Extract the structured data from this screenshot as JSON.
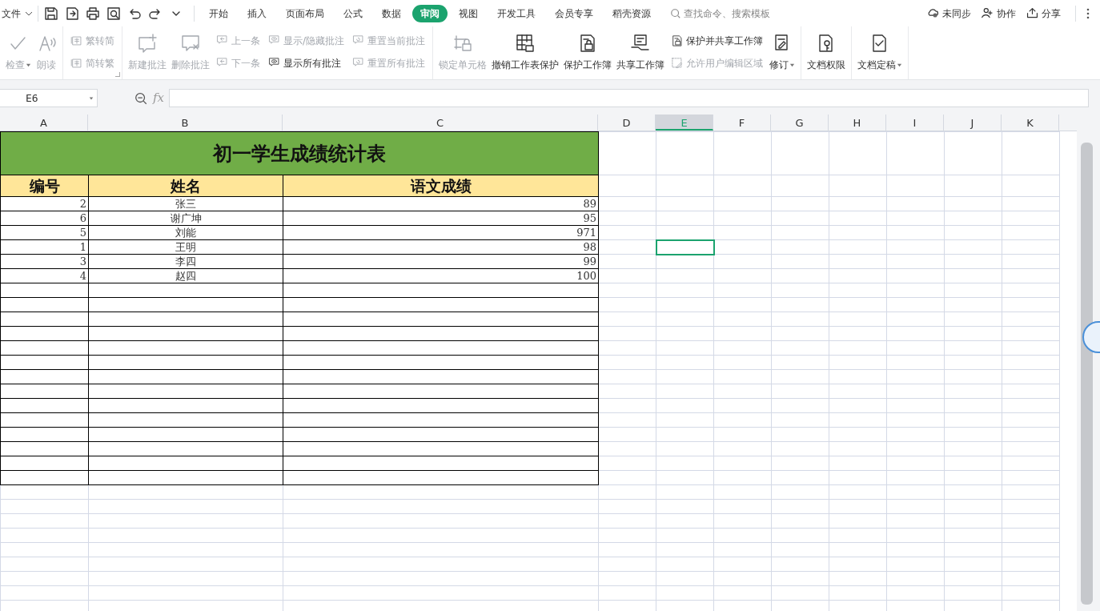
{
  "menu": {
    "file": "文件"
  },
  "tabs": [
    {
      "label": "开始",
      "selected": false
    },
    {
      "label": "插入",
      "selected": false
    },
    {
      "label": "页面布局",
      "selected": false
    },
    {
      "label": "公式",
      "selected": false
    },
    {
      "label": "数据",
      "selected": false
    },
    {
      "label": "审阅",
      "selected": true
    },
    {
      "label": "视图",
      "selected": false
    },
    {
      "label": "开发工具",
      "selected": false
    },
    {
      "label": "会员专享",
      "selected": false
    },
    {
      "label": "稻壳资源",
      "selected": false
    }
  ],
  "search": {
    "placeholder": "查找命令、搜索模板"
  },
  "actions": [
    "未同步",
    "协作",
    "分享"
  ],
  "ribbon": {
    "groups": [
      {
        "items": [
          {
            "kind": "large",
            "label": "检查",
            "disabled": true,
            "dropdown": true
          },
          {
            "kind": "large",
            "label": "朗读",
            "disabled": true
          }
        ]
      },
      {
        "launcher": true,
        "items": [
          {
            "kind": "stack",
            "items": [
              {
                "label": "繁转简",
                "disabled": true
              },
              {
                "label": "简转繁",
                "disabled": true
              }
            ]
          }
        ]
      },
      {
        "items": [
          {
            "kind": "large",
            "label": "新建批注",
            "disabled": true
          },
          {
            "kind": "large",
            "label": "删除批注",
            "disabled": true
          },
          {
            "kind": "stack",
            "items": [
              {
                "label": "上一条",
                "disabled": true
              },
              {
                "label": "下一条",
                "disabled": true
              }
            ]
          },
          {
            "kind": "stack",
            "items": [
              {
                "label": "显示/隐藏批注",
                "disabled": true
              },
              {
                "label": "显示所有批注",
                "disabled": false
              }
            ]
          },
          {
            "kind": "stack",
            "items": [
              {
                "label": "重置当前批注",
                "disabled": true
              },
              {
                "label": "重置所有批注",
                "disabled": true
              }
            ]
          }
        ]
      },
      {
        "items": [
          {
            "kind": "large",
            "label": "锁定单元格",
            "disabled": true
          },
          {
            "kind": "large",
            "label": "撤销工作表保护",
            "disabled": false
          },
          {
            "kind": "large",
            "label": "保护工作簿",
            "disabled": false
          },
          {
            "kind": "large",
            "label": "共享工作簿",
            "disabled": false
          },
          {
            "kind": "stack",
            "items": [
              {
                "label": "保护并共享工作簿",
                "disabled": false
              },
              {
                "label": "允许用户编辑区域",
                "disabled": true
              }
            ]
          },
          {
            "kind": "large",
            "label": "修订",
            "disabled": false,
            "dropdown": true
          }
        ]
      },
      {
        "items": [
          {
            "kind": "large",
            "label": "文档权限",
            "disabled": false
          }
        ]
      },
      {
        "items": [
          {
            "kind": "large",
            "label": "文档定稿",
            "disabled": false,
            "dropdown": true
          }
        ]
      }
    ]
  },
  "formula_bar": {
    "name_box": "E6",
    "fx": "fx"
  },
  "columns": [
    {
      "label": "A",
      "selected": false
    },
    {
      "label": "B",
      "selected": false
    },
    {
      "label": "C",
      "selected": false
    },
    {
      "label": "D",
      "selected": false
    },
    {
      "label": "E",
      "selected": true
    },
    {
      "label": "F",
      "selected": false
    },
    {
      "label": "G",
      "selected": false
    },
    {
      "label": "H",
      "selected": false
    },
    {
      "label": "I",
      "selected": false
    },
    {
      "label": "J",
      "selected": false
    },
    {
      "label": "K",
      "selected": false
    }
  ],
  "table": {
    "title": "初一学生成绩统计表",
    "header": [
      "编号",
      "姓名",
      "语文成绩"
    ],
    "rows": [
      {
        "cells": [
          "2",
          "张三",
          "89"
        ],
        "selected": false
      },
      {
        "cells": [
          "6",
          "谢广坤",
          "95"
        ],
        "selected": false
      },
      {
        "cells": [
          "5",
          "刘能",
          "971"
        ],
        "selected": false
      },
      {
        "cells": [
          "1",
          "王明",
          "98"
        ],
        "selected": true
      },
      {
        "cells": [
          "3",
          "李四",
          "99"
        ],
        "selected": false
      },
      {
        "cells": [
          "4",
          "赵四",
          "100"
        ],
        "selected": false
      }
    ]
  }
}
